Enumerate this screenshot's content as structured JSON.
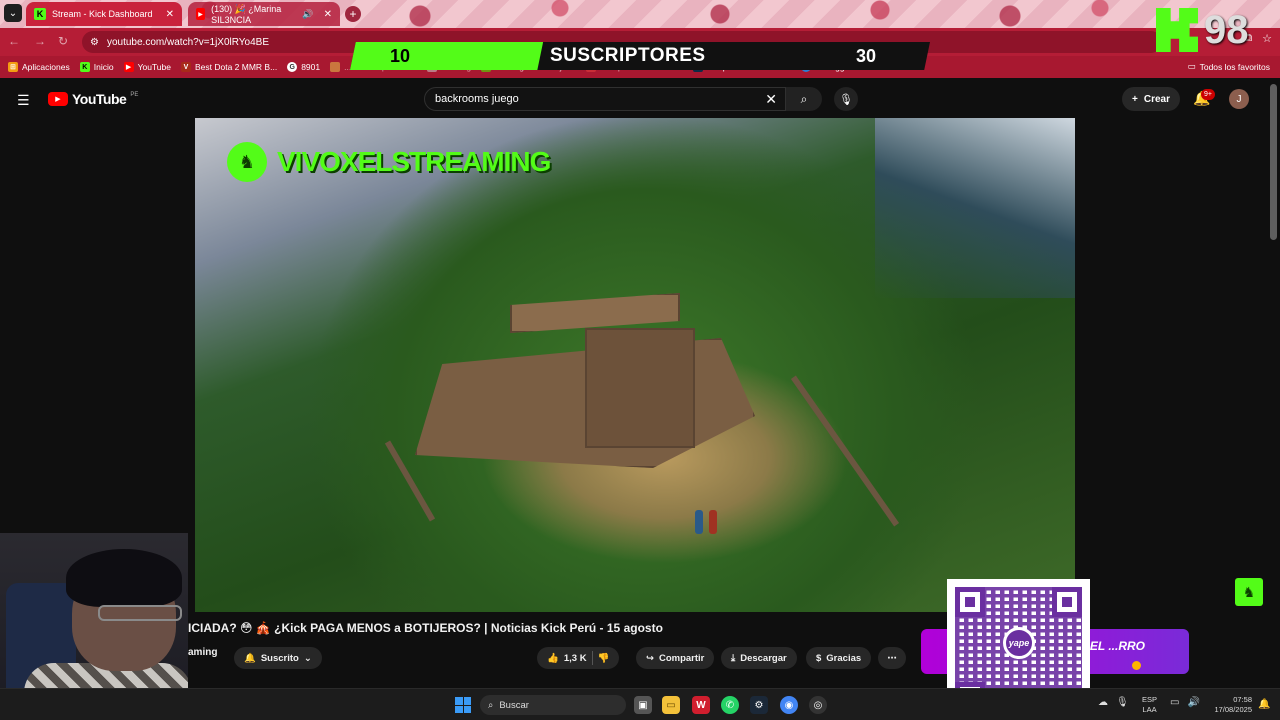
{
  "browser": {
    "tabs": [
      {
        "label": "Stream - Kick Dashboard",
        "active": true
      },
      {
        "label": "(130) 🎉 ¿Marina SIL3NCIA",
        "active": false
      }
    ],
    "url": "youtube.com/watch?v=1jX0lRYo4BE",
    "bookmarks": [
      {
        "label": "Aplicaciones",
        "icon": "apps-grid-icon"
      },
      {
        "label": "Inicio",
        "icon": "kick-icon"
      },
      {
        "label": "YouTube",
        "icon": "youtube-icon"
      },
      {
        "label": "Best Dota 2 MMR B...",
        "icon": "dota-icon"
      },
      {
        "label": "8901",
        "icon": "globe-icon"
      },
      {
        "label": "...eta de aprendiz...",
        "icon": "folder-icon"
      },
      {
        "label": "Loading",
        "icon": "page-icon"
      },
      {
        "label": "Duolingo - La mejor...",
        "icon": "duolingo-icon"
      },
      {
        "label": "Comprar en USA de...",
        "icon": "cart-icon"
      },
      {
        "label": "DeepL Translate - El...",
        "icon": "deepl-icon"
      },
      {
        "label": "IP Logger URL Short...",
        "icon": "iplogger-icon"
      }
    ],
    "bookmarks_all": "Todos los favoritos"
  },
  "stream_overlay": {
    "sub_current": "10",
    "sub_label": "SUSCRIPTORES",
    "sub_goal": "30",
    "sub_progress": 0.333,
    "kick_count": "98",
    "brand_text": "VIVOXELSTREAMING",
    "accent": "#53fc18"
  },
  "youtube": {
    "logo_text": "YouTube",
    "region": "PE",
    "search_value": "backrooms juego",
    "create_label": "Crear",
    "notif_badge": "9+",
    "avatar_letter": "J",
    "video_title": "ICIADA? 😳 🎪 ¿Kick PAGA MENOS a BOTIJEROS? | Noticias Kick Perú - 15 agosto",
    "channel_fragment": "aming",
    "subscribe_label": "Suscrito",
    "like_count": "1,3 K",
    "share_label": "Compartir",
    "download_label": "Descargar",
    "thanks_label": "Gracias",
    "ad_text": "S DEL ...RRO"
  },
  "qr": {
    "center_text": "yape"
  },
  "taskbar": {
    "search_label": "Buscar",
    "lang_top": "ESP",
    "lang_bottom": "LAA",
    "time": "07:58",
    "date": "17/08/2025"
  }
}
